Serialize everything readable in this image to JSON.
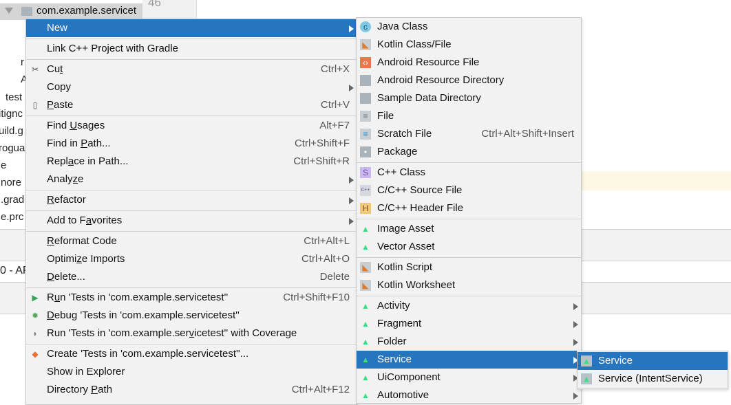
{
  "editor": {
    "line_number": "46"
  },
  "tree": {
    "selected": "com.example.servicet",
    "fragments": [
      "r",
      "A",
      "test",
      "itignc",
      "uild.g",
      "rogua",
      "e",
      "nore",
      ".grad",
      "e.prc",
      "0 - AP"
    ]
  },
  "colors": {
    "highlight": "#2675bf",
    "menu_bg": "#f2f2f2",
    "android_green": "#3ddc84"
  },
  "main_menu": [
    {
      "label": "New",
      "arrow": true,
      "highlighted": true
    },
    {
      "sep": true
    },
    {
      "label": "Link C++ Project with Gradle"
    },
    {
      "sep": true
    },
    {
      "label": "Cut",
      "mnemonic": "t",
      "shortcut": "Ctrl+X",
      "icon": "scissors-icon"
    },
    {
      "label": "Copy",
      "arrow": true
    },
    {
      "label": "Paste",
      "mnemonic": "P",
      "shortcut": "Ctrl+V",
      "icon": "clipboard-icon"
    },
    {
      "sep": true
    },
    {
      "label": "Find Usages",
      "mnemonic": "U",
      "shortcut": "Alt+F7"
    },
    {
      "label": "Find in Path...",
      "mnemonic": "P",
      "shortcut": "Ctrl+Shift+F"
    },
    {
      "label": "Replace in Path...",
      "mnemonic": "a",
      "shortcut": "Ctrl+Shift+R"
    },
    {
      "label": "Analyze",
      "mnemonic": "z",
      "arrow": true
    },
    {
      "sep": true
    },
    {
      "label": "Refactor",
      "mnemonic": "R",
      "arrow": true
    },
    {
      "sep": true
    },
    {
      "label": "Add to Favorites",
      "mnemonic": "a",
      "arrow": true
    },
    {
      "sep": true
    },
    {
      "label": "Reformat Code",
      "mnemonic": "R",
      "shortcut": "Ctrl+Alt+L"
    },
    {
      "label": "Optimize Imports",
      "mnemonic": "z",
      "shortcut": "Ctrl+Alt+O"
    },
    {
      "label": "Delete...",
      "mnemonic": "D",
      "shortcut": "Delete"
    },
    {
      "sep": true
    },
    {
      "label": "Run 'Tests in 'com.example.servicetest''",
      "mnemonic": "u",
      "shortcut": "Ctrl+Shift+F10",
      "icon": "run-icon"
    },
    {
      "label": "Debug 'Tests in 'com.example.servicetest''",
      "mnemonic": "D",
      "icon": "debug-icon"
    },
    {
      "label": "Run 'Tests in 'com.example.servicetest'' with Coverage",
      "mnemonic": "v",
      "icon": "coverage-icon"
    },
    {
      "sep": true
    },
    {
      "label": "Create 'Tests in 'com.example.servicetest''...",
      "icon": "create-test-icon"
    },
    {
      "label": "Show in Explorer"
    },
    {
      "label": "Directory Path",
      "mnemonic": "P",
      "shortcut": "Ctrl+Alt+F12"
    }
  ],
  "new_menu": [
    {
      "label": "Java Class",
      "icon": "java-class-icon"
    },
    {
      "label": "Kotlin Class/File",
      "icon": "kotlin-file-icon"
    },
    {
      "label": "Android Resource File",
      "icon": "android-resource-file-icon"
    },
    {
      "label": "Android Resource Directory",
      "icon": "folder-icon"
    },
    {
      "label": "Sample Data Directory",
      "icon": "folder-icon"
    },
    {
      "label": "File",
      "icon": "file-icon"
    },
    {
      "label": "Scratch File",
      "shortcut": "Ctrl+Alt+Shift+Insert",
      "icon": "scratch-file-icon"
    },
    {
      "label": "Package",
      "icon": "package-icon"
    },
    {
      "sep": true
    },
    {
      "label": "C++ Class",
      "icon": "cpp-class-icon"
    },
    {
      "label": "C/C++ Source File",
      "icon": "cpp-source-icon"
    },
    {
      "label": "C/C++ Header File",
      "icon": "cpp-header-icon"
    },
    {
      "sep": true
    },
    {
      "label": "Image Asset",
      "icon": "android-icon"
    },
    {
      "label": "Vector Asset",
      "icon": "android-icon"
    },
    {
      "sep": true
    },
    {
      "label": "Kotlin Script",
      "icon": "kotlin-file-icon"
    },
    {
      "label": "Kotlin Worksheet",
      "icon": "kotlin-file-icon"
    },
    {
      "sep": true
    },
    {
      "label": "Activity",
      "icon": "android-icon",
      "arrow": true
    },
    {
      "label": "Fragment",
      "icon": "android-icon",
      "arrow": true
    },
    {
      "label": "Folder",
      "icon": "android-icon",
      "arrow": true
    },
    {
      "label": "Service",
      "icon": "android-icon",
      "arrow": true,
      "highlighted": true
    },
    {
      "label": "UiComponent",
      "icon": "android-icon",
      "arrow": true
    },
    {
      "label": "Automotive",
      "icon": "android-icon",
      "arrow": true
    }
  ],
  "service_menu": [
    {
      "label": "Service",
      "icon": "android-file-icon",
      "highlighted": true
    },
    {
      "label": "Service (IntentService)",
      "icon": "android-file-icon"
    }
  ]
}
